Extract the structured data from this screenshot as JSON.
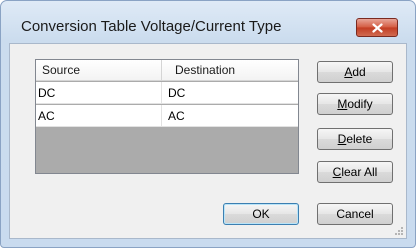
{
  "window": {
    "title": "Conversion Table Voltage/Current Type",
    "close_icon": "close-icon",
    "close_color": "#c74a31"
  },
  "table": {
    "columns": [
      "Source",
      "Destination"
    ],
    "rows": [
      {
        "source": "DC",
        "destination": "DC"
      },
      {
        "source": "AC",
        "destination": "AC"
      }
    ]
  },
  "buttons": {
    "add": "Add",
    "modify": "Modify",
    "delete": "Delete",
    "clear_all": "Clear All",
    "ok": "OK",
    "cancel": "Cancel"
  }
}
